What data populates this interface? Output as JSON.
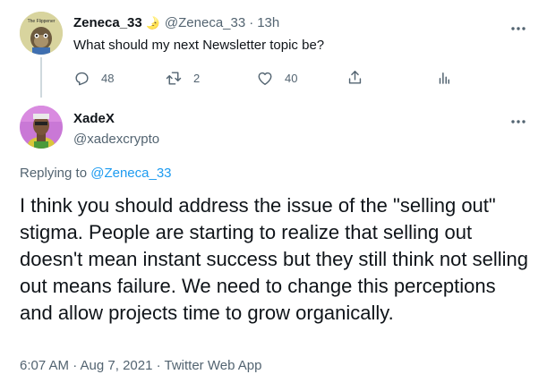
{
  "parent_tweet": {
    "display_name": "Zeneca_33",
    "name_emoji": "🌛",
    "handle": "@Zeneca_33",
    "separator": "·",
    "time": "13h",
    "avatar_caption": "The Flippener",
    "text": "What should my next Newsletter topic be?",
    "stats": {
      "replies": "48",
      "retweets": "2",
      "likes": "40"
    }
  },
  "reply_tweet": {
    "display_name": "XadeX",
    "handle": "@xadexcrypto",
    "replying_prefix": "Replying to",
    "replying_handle": "@Zeneca_33",
    "text": "I think you should address the issue of the \"selling out\" stigma. People are starting to realize that selling out doesn't mean instant success but they still think not selling out means failure. We need to change this perceptions and allow projects time to grow organically.",
    "timestamp": "6:07 AM · Aug 7, 2021 · Twitter Web App"
  },
  "colors": {
    "accent": "#1d9bf0",
    "text": "#0f1419",
    "muted": "#536471",
    "line": "#cfd9de"
  },
  "icons": [
    "more-icon",
    "reply-icon",
    "retweet-icon",
    "like-icon",
    "share-icon",
    "analytics-icon"
  ]
}
